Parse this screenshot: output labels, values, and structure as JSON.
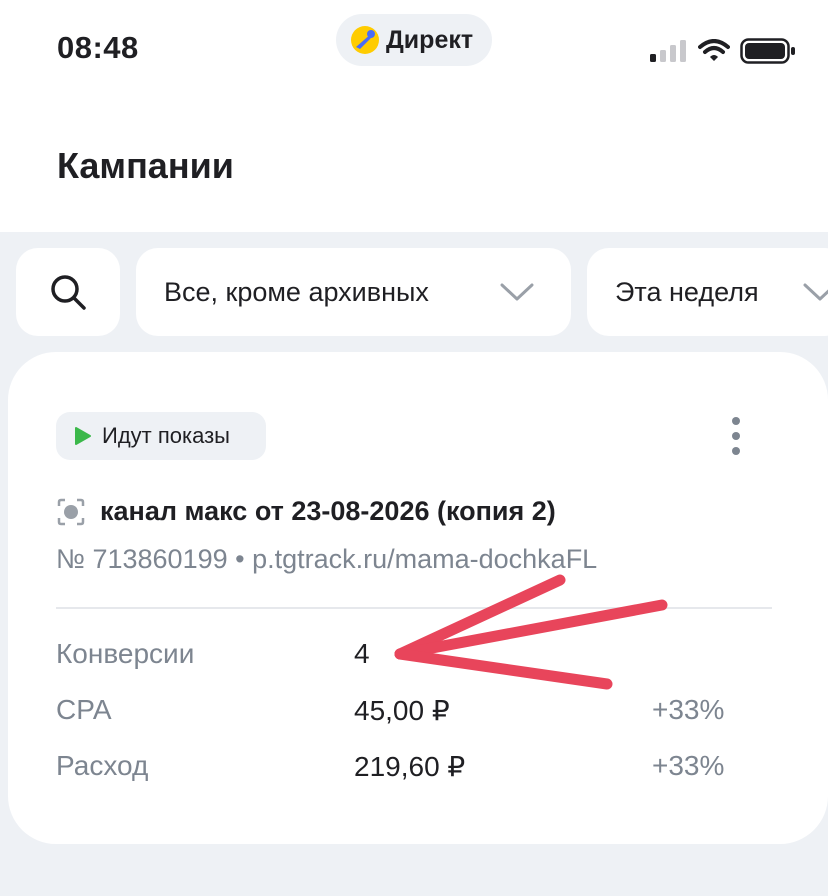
{
  "status_bar": {
    "time": "08:48",
    "app_label": "Директ"
  },
  "header": {
    "title": "Кампании"
  },
  "filters": {
    "status_filter": "Все, кроме архивных",
    "period_filter": "Эта неделя"
  },
  "campaign": {
    "badge": "Идут показы",
    "name": "канал макс от 23-08-2026 (копия 2)",
    "subtitle": "№ 713860199 • p.tgtrack.ru/mama-dochkaFL",
    "metrics": [
      {
        "label": "Конверсии",
        "value": "4",
        "change": ""
      },
      {
        "label": "CPA",
        "value": "45,00 ₽",
        "change": "+33%"
      },
      {
        "label": "Расход",
        "value": "219,60 ₽",
        "change": "+33%"
      }
    ]
  },
  "colors": {
    "accent_green": "#3bb84a",
    "annotation_red": "#e8455b",
    "logo_yellow": "#ffcc00",
    "logo_blue": "#4a6cf7"
  }
}
